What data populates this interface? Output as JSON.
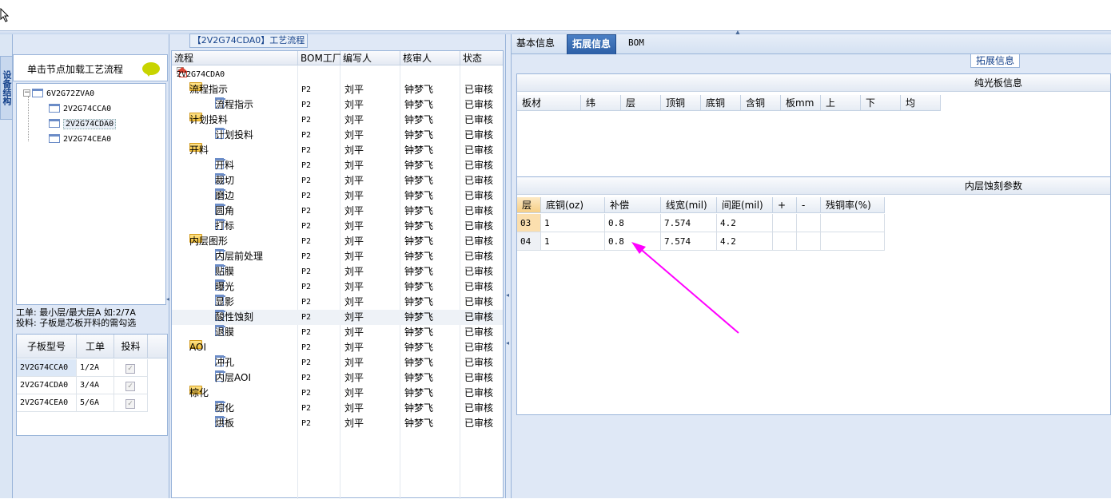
{
  "left_panel": {
    "tab_label": "设备结构",
    "header_text": "单击节点加载工艺流程",
    "tree": [
      {
        "label": "6V2G72ZVA0",
        "level": 0
      },
      {
        "label": "2V2G74CCA0",
        "level": 1
      },
      {
        "label": "2V2G74CDA0",
        "level": 1,
        "selected": true
      },
      {
        "label": "2V2G74CEA0",
        "level": 1
      }
    ],
    "note_line1": "工单: 最小层/最大层A 如:2/7A",
    "note_line2": "投料: 子板是芯板开料的需勾选",
    "table": {
      "headers": [
        "子板型号",
        "工单",
        "投料"
      ],
      "rows": [
        {
          "model": "2V2G74CCA0",
          "order": "1/2A",
          "feed": "✓"
        },
        {
          "model": "2V2G74CDA0",
          "order": "3/4A",
          "feed": "✓"
        },
        {
          "model": "2V2G74CEA0",
          "order": "5/6A",
          "feed": "✓"
        }
      ]
    }
  },
  "middle_panel": {
    "title": "【2V2G74CDA0】工艺流程",
    "headers": [
      "流程",
      "BOM工厂",
      "编写人",
      "核审人",
      "状态"
    ],
    "rows": [
      {
        "name": "2V2G74CDA0",
        "type": "root",
        "bom": "",
        "writer": "",
        "reviewer": "",
        "status": ""
      },
      {
        "name": "流程指示",
        "type": "folder",
        "bom": "P2",
        "writer": "刘平",
        "reviewer": "钟梦飞",
        "status": "已审核"
      },
      {
        "name": "流程指示",
        "type": "leaf",
        "bom": "P2",
        "writer": "刘平",
        "reviewer": "钟梦飞",
        "status": "已审核"
      },
      {
        "name": "计划投料",
        "type": "folder",
        "bom": "P2",
        "writer": "刘平",
        "reviewer": "钟梦飞",
        "status": "已审核"
      },
      {
        "name": "计划投料",
        "type": "leaf",
        "bom": "P2",
        "writer": "刘平",
        "reviewer": "钟梦飞",
        "status": "已审核"
      },
      {
        "name": "开料",
        "type": "folder",
        "bom": "P2",
        "writer": "刘平",
        "reviewer": "钟梦飞",
        "status": "已审核"
      },
      {
        "name": "开料",
        "type": "leaf",
        "bom": "P2",
        "writer": "刘平",
        "reviewer": "钟梦飞",
        "status": "已审核"
      },
      {
        "name": "裁切",
        "type": "leaf",
        "bom": "P2",
        "writer": "刘平",
        "reviewer": "钟梦飞",
        "status": "已审核"
      },
      {
        "name": "磨边",
        "type": "leaf",
        "bom": "P2",
        "writer": "刘平",
        "reviewer": "钟梦飞",
        "status": "已审核"
      },
      {
        "name": "圆角",
        "type": "leaf",
        "bom": "P2",
        "writer": "刘平",
        "reviewer": "钟梦飞",
        "status": "已审核"
      },
      {
        "name": "打标",
        "type": "leaf",
        "bom": "P2",
        "writer": "刘平",
        "reviewer": "钟梦飞",
        "status": "已审核"
      },
      {
        "name": "内层图形",
        "type": "folder",
        "bom": "P2",
        "writer": "刘平",
        "reviewer": "钟梦飞",
        "status": "已审核"
      },
      {
        "name": "内层前处理",
        "type": "leaf",
        "bom": "P2",
        "writer": "刘平",
        "reviewer": "钟梦飞",
        "status": "已审核"
      },
      {
        "name": "贴膜",
        "type": "leaf",
        "bom": "P2",
        "writer": "刘平",
        "reviewer": "钟梦飞",
        "status": "已审核"
      },
      {
        "name": "曝光",
        "type": "leaf",
        "bom": "P2",
        "writer": "刘平",
        "reviewer": "钟梦飞",
        "status": "已审核"
      },
      {
        "name": "显影",
        "type": "leaf",
        "bom": "P2",
        "writer": "刘平",
        "reviewer": "钟梦飞",
        "status": "已审核"
      },
      {
        "name": "酸性蚀刻",
        "type": "leaf",
        "bom": "P2",
        "writer": "刘平",
        "reviewer": "钟梦飞",
        "status": "已审核",
        "selected": true
      },
      {
        "name": "退膜",
        "type": "leaf",
        "bom": "P2",
        "writer": "刘平",
        "reviewer": "钟梦飞",
        "status": "已审核"
      },
      {
        "name": "AOI",
        "type": "folder",
        "bom": "P2",
        "writer": "刘平",
        "reviewer": "钟梦飞",
        "status": "已审核"
      },
      {
        "name": "冲孔",
        "type": "leaf",
        "bom": "P2",
        "writer": "刘平",
        "reviewer": "钟梦飞",
        "status": "已审核"
      },
      {
        "name": "内层AOI",
        "type": "leaf",
        "bom": "P2",
        "writer": "刘平",
        "reviewer": "钟梦飞",
        "status": "已审核"
      },
      {
        "name": "棕化",
        "type": "folder",
        "bom": "P2",
        "writer": "刘平",
        "reviewer": "钟梦飞",
        "status": "已审核"
      },
      {
        "name": "棕化",
        "type": "leaf",
        "bom": "P2",
        "writer": "刘平",
        "reviewer": "钟梦飞",
        "status": "已审核"
      },
      {
        "name": "烘板",
        "type": "leaf",
        "bom": "P2",
        "writer": "刘平",
        "reviewer": "钟梦飞",
        "status": "已审核"
      }
    ]
  },
  "right_panel": {
    "tabs": [
      {
        "label": "基本信息",
        "active": false
      },
      {
        "label": "拓展信息",
        "active": true
      },
      {
        "label": "BOM",
        "active": false
      }
    ],
    "group_legend": "拓展信息",
    "section1": {
      "title": "纯光板信息",
      "headers": [
        "板材",
        "纬",
        "层",
        "顶铜",
        "底铜",
        "含铜",
        "板mm",
        "上",
        "下",
        "均"
      ]
    },
    "section2": {
      "title": "内层蚀刻参数",
      "headers": [
        "层",
        "底铜(oz)",
        "补偿",
        "线宽(mil)",
        "间距(mil)",
        "+",
        "-",
        "残铜率(%)"
      ],
      "rows": [
        {
          "layer": "03",
          "base": "1",
          "comp": "0.8",
          "width": "7.574",
          "spacing": "4.2",
          "plus": "",
          "minus": "",
          "residual": ""
        },
        {
          "layer": "04",
          "base": "1",
          "comp": "0.8",
          "width": "7.574",
          "spacing": "4.2",
          "plus": "",
          "minus": "",
          "residual": ""
        }
      ]
    },
    "annotation_color": "#ff00ff"
  }
}
